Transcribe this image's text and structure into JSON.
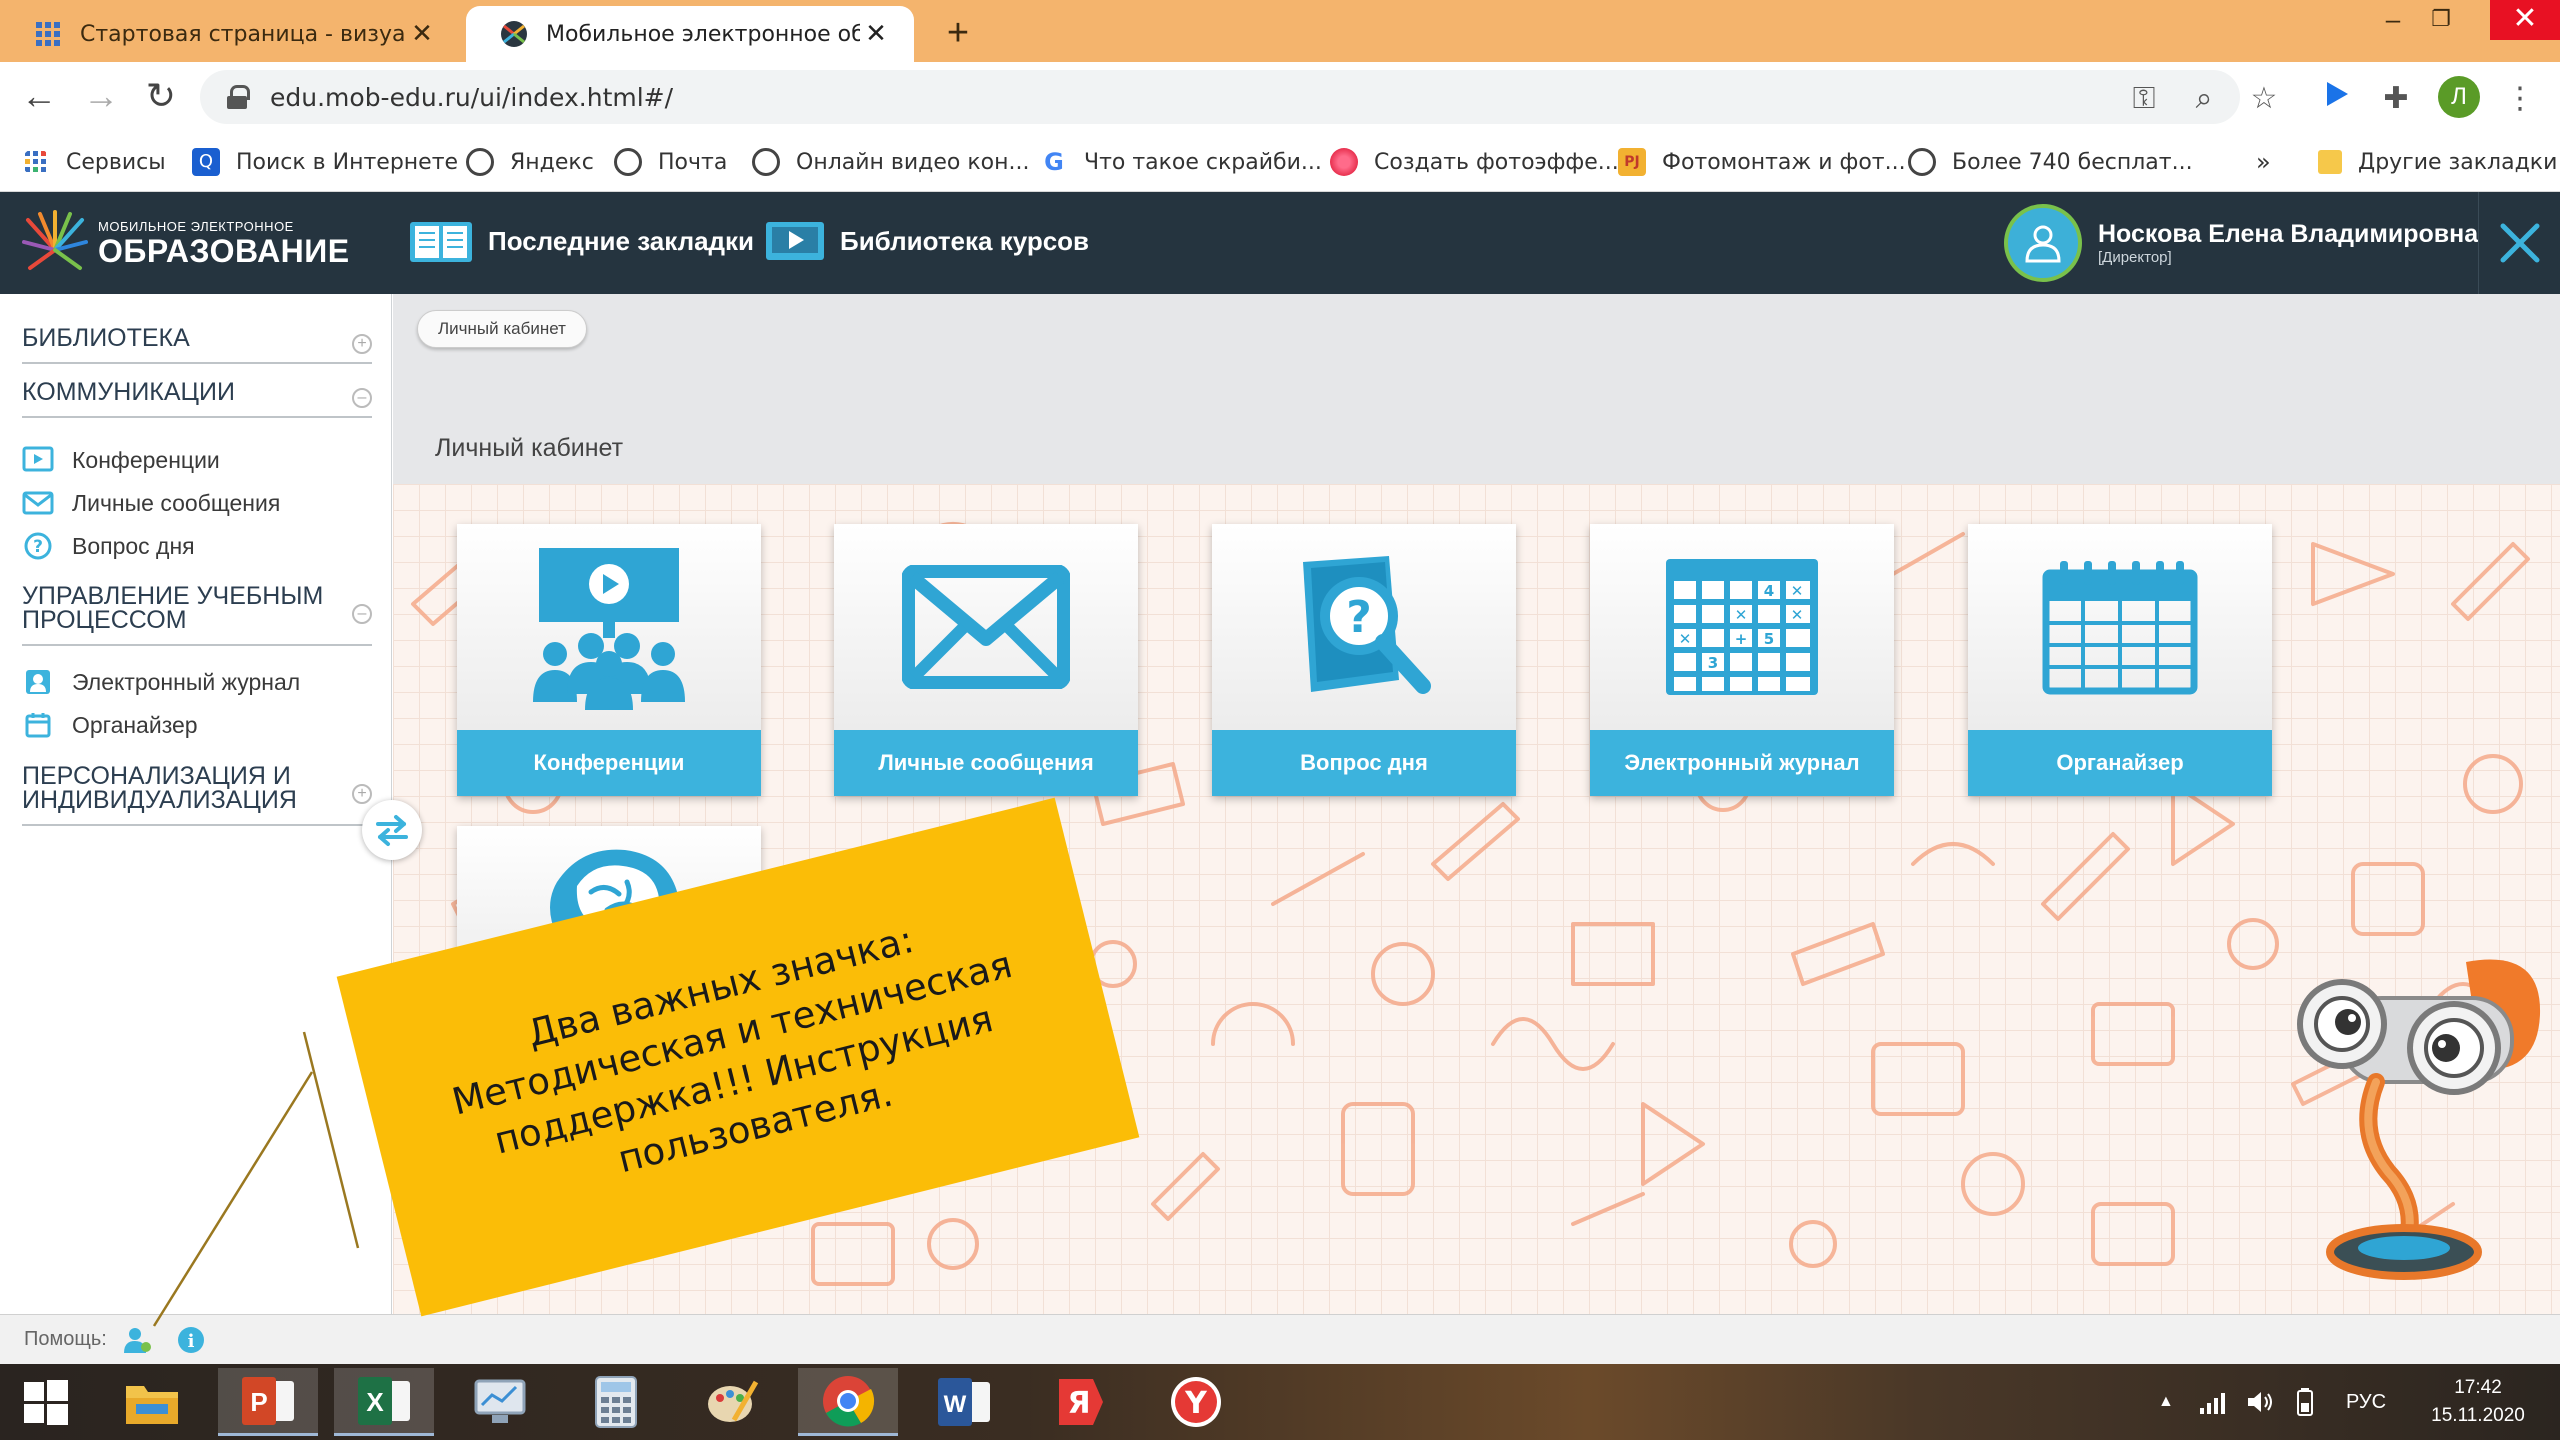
{
  "browser": {
    "tabs": [
      {
        "title": "Стартовая страница - визуальн",
        "active": false
      },
      {
        "title": "Мобильное электронное обра:",
        "active": true
      }
    ],
    "new_tab_label": "+",
    "tab_close_glyph": "✕",
    "window_controls": {
      "minimize": "–",
      "restore": "❐",
      "close": "✕"
    },
    "url": "edu.mob-edu.ru/ui/index.html#/",
    "profile_initial": "Л",
    "bookmarks": [
      {
        "label": "Сервисы",
        "icon": "apps-grid-icon"
      },
      {
        "label": "Поиск в Интернете",
        "icon": "search-icon"
      },
      {
        "label": "Яндекс",
        "icon": "globe-icon"
      },
      {
        "label": "Почта",
        "icon": "globe-icon"
      },
      {
        "label": "Онлайн видео кон...",
        "icon": "globe-icon"
      },
      {
        "label": "Что такое скрайби...",
        "icon": "google-icon"
      },
      {
        "label": "Создать фотоэффе...",
        "icon": "flower-icon"
      },
      {
        "label": "Фотомонтаж и фот...",
        "icon": "pj-icon"
      },
      {
        "label": "Более 740 бесплат...",
        "icon": "globe-icon"
      }
    ],
    "bookmarks_overflow": "»",
    "other_bookmarks": "Другие закладки"
  },
  "app": {
    "logo_small": "МОБИЛЬНОЕ ЭЛЕКТРОННОЕ",
    "logo_big": "ОБРАЗОВАНИЕ",
    "nav": [
      {
        "label": "Последние закладки",
        "icon": "book-icon"
      },
      {
        "label": "Библиотека курсов",
        "icon": "video-icon"
      }
    ],
    "user": {
      "name": "Носкова Елена Владимировна",
      "role": "[Директор]"
    }
  },
  "sidebar": {
    "sections": [
      {
        "title": "БИБЛИОТЕКА",
        "toggle": "+"
      },
      {
        "title": "КОММУНИКАЦИИ",
        "toggle": "–"
      },
      {
        "title": "УПРАВЛЕНИЕ УЧЕБНЫМ ПРОЦЕССОМ",
        "toggle": "–"
      },
      {
        "title": "ПЕРСОНАЛИЗАЦИЯ И ИНДИВИДУАЛИЗАЦИЯ",
        "toggle": "+"
      }
    ],
    "items": [
      {
        "label": "Конференции",
        "icon": "video-play-icon"
      },
      {
        "label": "Личные сообщения",
        "icon": "envelope-icon"
      },
      {
        "label": "Вопрос дня",
        "icon": "question-circle-icon"
      },
      {
        "label": "Электронный журнал",
        "icon": "journal-person-icon"
      },
      {
        "label": "Органайзер",
        "icon": "calendar-icon"
      }
    ]
  },
  "main": {
    "breadcrumb": "Личный кабинет",
    "page_title": "Личный кабинет",
    "tiles": [
      {
        "label": "Конференции",
        "icon": "conference-icon"
      },
      {
        "label": "Личные сообщения",
        "icon": "envelope-icon"
      },
      {
        "label": "Вопрос дня",
        "icon": "question-search-icon"
      },
      {
        "label": "Электронный журнал",
        "icon": "grid-journal-icon"
      },
      {
        "label": "Органайзер",
        "icon": "calendar-icon"
      }
    ],
    "annotation": "Два важных значка: Методическая и техническая поддержка!!! Инструкция пользователя."
  },
  "footer": {
    "help_label": "Помощь:"
  },
  "taskbar": {
    "apps": [
      "windows-start-icon",
      "file-explorer-icon",
      "powerpoint-icon",
      "excel-icon",
      "monitor-icon",
      "calculator-icon",
      "paint-icon",
      "chrome-icon",
      "word-icon",
      "yandex-icon",
      "yandex-browser-icon"
    ],
    "lang": "РУС",
    "time": "17:42",
    "date": "15.11.2020"
  },
  "colors": {
    "tabstrip": "#f4b46d",
    "header": "#25343f",
    "tile_label": "#3cb3dd",
    "annotation": "#fbbd07",
    "pattern": "#f4a98a"
  }
}
